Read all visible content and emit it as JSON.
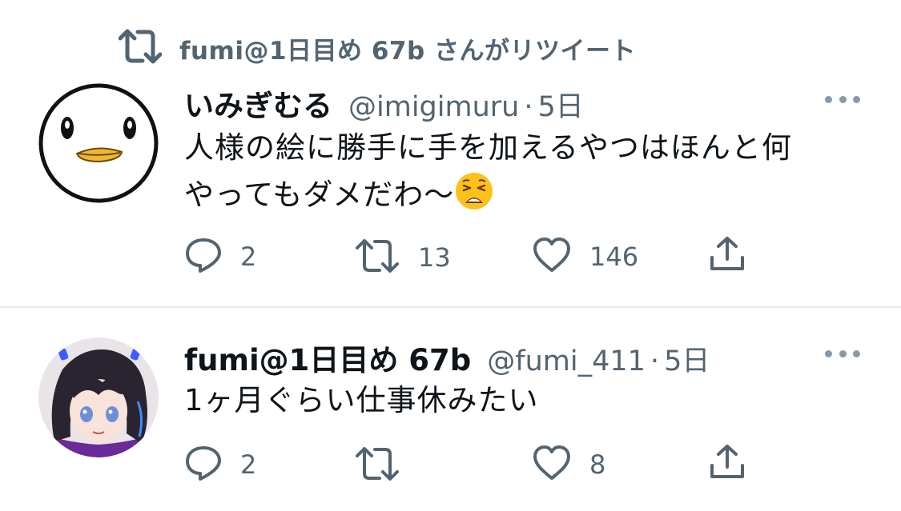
{
  "retweet_banner": {
    "text": "fumi@1日目め 67b さんがリツイート"
  },
  "tweets": [
    {
      "display_name": "いみぎむる",
      "handle": "@imigimuru",
      "separator": "·",
      "time": "5日",
      "text_line1": "人様の絵に勝手に手を加えるやつはほんと何",
      "text_line2": "やってもダメだわ〜",
      "emoji": "weary-face",
      "replies": "2",
      "retweets": "13",
      "likes": "146"
    },
    {
      "display_name": "fumi@1日目め 67b",
      "handle": "@fumi_411",
      "separator": "·",
      "time": "5日",
      "text_line1": "1ヶ月ぐらい仕事休みたい",
      "replies": "2",
      "retweets": "",
      "likes": "8"
    }
  ],
  "colors": {
    "text_primary": "#0f1419",
    "text_secondary": "#536471",
    "divider": "#e6e9eb"
  }
}
